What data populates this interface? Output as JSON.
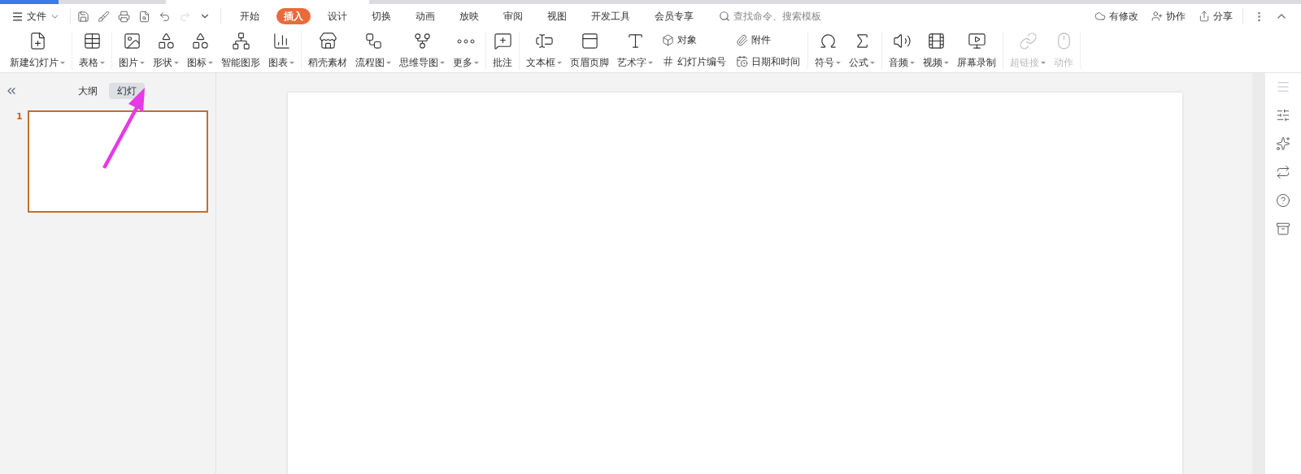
{
  "file_menu": {
    "label": "文件"
  },
  "menu_tabs": [
    {
      "label": "开始",
      "selected": false
    },
    {
      "label": "插入",
      "selected": true
    },
    {
      "label": "设计",
      "selected": false
    },
    {
      "label": "切换",
      "selected": false
    },
    {
      "label": "动画",
      "selected": false
    },
    {
      "label": "放映",
      "selected": false
    },
    {
      "label": "审阅",
      "selected": false
    },
    {
      "label": "视图",
      "selected": false
    },
    {
      "label": "开发工具",
      "selected": false
    },
    {
      "label": "会员专享",
      "selected": false
    }
  ],
  "search": {
    "placeholder": "查找命令、搜索模板"
  },
  "header_actions": [
    {
      "kind": "cloud",
      "label": "有修改"
    },
    {
      "kind": "collab",
      "label": "协作"
    },
    {
      "kind": "share",
      "label": "分享"
    }
  ],
  "ribbon_groups": [
    {
      "items": [
        {
          "kind": "new-slide",
          "label": "新建幻灯片",
          "dropdown": true,
          "disabled": false
        }
      ]
    },
    {
      "items": [
        {
          "kind": "table",
          "label": "表格",
          "dropdown": true,
          "disabled": false
        }
      ]
    },
    {
      "items": [
        {
          "kind": "image",
          "label": "图片",
          "dropdown": true,
          "disabled": false
        },
        {
          "kind": "shape",
          "label": "形状",
          "dropdown": true,
          "disabled": false
        },
        {
          "kind": "icons",
          "label": "图标",
          "dropdown": true,
          "disabled": false
        },
        {
          "kind": "smartart",
          "label": "智能图形",
          "dropdown": false,
          "disabled": false
        },
        {
          "kind": "chart",
          "label": "图表",
          "dropdown": true,
          "disabled": false
        }
      ]
    },
    {
      "items": [
        {
          "kind": "store",
          "label": "稻壳素材",
          "dropdown": false,
          "disabled": false
        },
        {
          "kind": "flow",
          "label": "流程图",
          "dropdown": true,
          "disabled": false
        },
        {
          "kind": "mindmap",
          "label": "思维导图",
          "dropdown": true,
          "disabled": false
        },
        {
          "kind": "more",
          "label": "更多",
          "dropdown": true,
          "disabled": false
        }
      ]
    },
    {
      "items": [
        {
          "kind": "comment",
          "label": "批注",
          "dropdown": false,
          "disabled": false
        }
      ]
    },
    {
      "items": [
        {
          "kind": "textbox",
          "label": "文本框",
          "dropdown": true,
          "disabled": false
        },
        {
          "kind": "header",
          "label": "页眉页脚",
          "dropdown": false,
          "disabled": false
        },
        {
          "kind": "wordart",
          "label": "艺术字",
          "dropdown": true,
          "disabled": false
        }
      ],
      "small": [
        {
          "kind": "object",
          "label": "对象"
        },
        {
          "kind": "attach",
          "label": "附件"
        },
        {
          "kind": "number",
          "label": "幻灯片编号"
        },
        {
          "kind": "date",
          "label": "日期和时间"
        }
      ]
    },
    {
      "items": [
        {
          "kind": "symbol",
          "label": "符号",
          "dropdown": true,
          "disabled": false
        },
        {
          "kind": "formula",
          "label": "公式",
          "dropdown": true,
          "disabled": false
        }
      ]
    },
    {
      "items": [
        {
          "kind": "audio",
          "label": "音频",
          "dropdown": true,
          "disabled": false
        },
        {
          "kind": "video",
          "label": "视频",
          "dropdown": true,
          "disabled": false
        },
        {
          "kind": "record",
          "label": "屏幕录制",
          "dropdown": false,
          "disabled": false
        }
      ]
    },
    {
      "items": [
        {
          "kind": "link",
          "label": "超链接",
          "dropdown": true,
          "disabled": true
        },
        {
          "kind": "action",
          "label": "动作",
          "dropdown": false,
          "disabled": true
        }
      ]
    }
  ],
  "panel_tabs": [
    {
      "label": "大纲",
      "selected": false
    },
    {
      "label": "幻灯",
      "selected": true
    }
  ],
  "slides": [
    {
      "number": "1",
      "selected": true
    }
  ]
}
